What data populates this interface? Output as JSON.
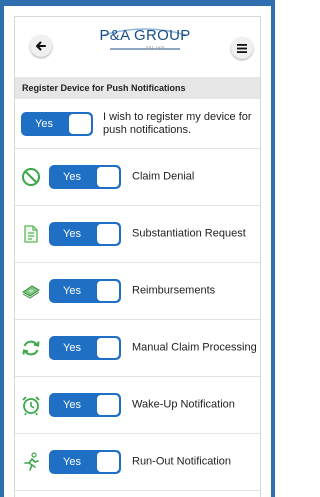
{
  "header": {
    "logo_text": "P&A GROUP",
    "logo_subtext": "EST. 1975",
    "back_icon": "arrow-left-icon",
    "menu_icon": "hamburger-menu-icon"
  },
  "section": {
    "title": "Register Device for Push Notifications"
  },
  "colors": {
    "accent": "#1f6fc5",
    "frame": "#2f6fb0",
    "icon_green": "#3aa84a"
  },
  "rows": [
    {
      "label": "I wish to register my device for push notifications.",
      "toggle": "Yes",
      "icon": ""
    },
    {
      "label": "Claim Denial",
      "toggle": "Yes",
      "icon": "prohibited-icon"
    },
    {
      "label": "Substantiation Request",
      "toggle": "Yes",
      "icon": "document-icon"
    },
    {
      "label": "Reimbursements",
      "toggle": "Yes",
      "icon": "money-icon"
    },
    {
      "label": "Manual Claim Processing",
      "toggle": "Yes",
      "icon": "refresh-icon"
    },
    {
      "label": "Wake-Up Notification",
      "toggle": "Yes",
      "icon": "alarm-clock-icon"
    },
    {
      "label": "Run-Out Notification",
      "toggle": "Yes",
      "icon": "running-person-icon"
    }
  ]
}
